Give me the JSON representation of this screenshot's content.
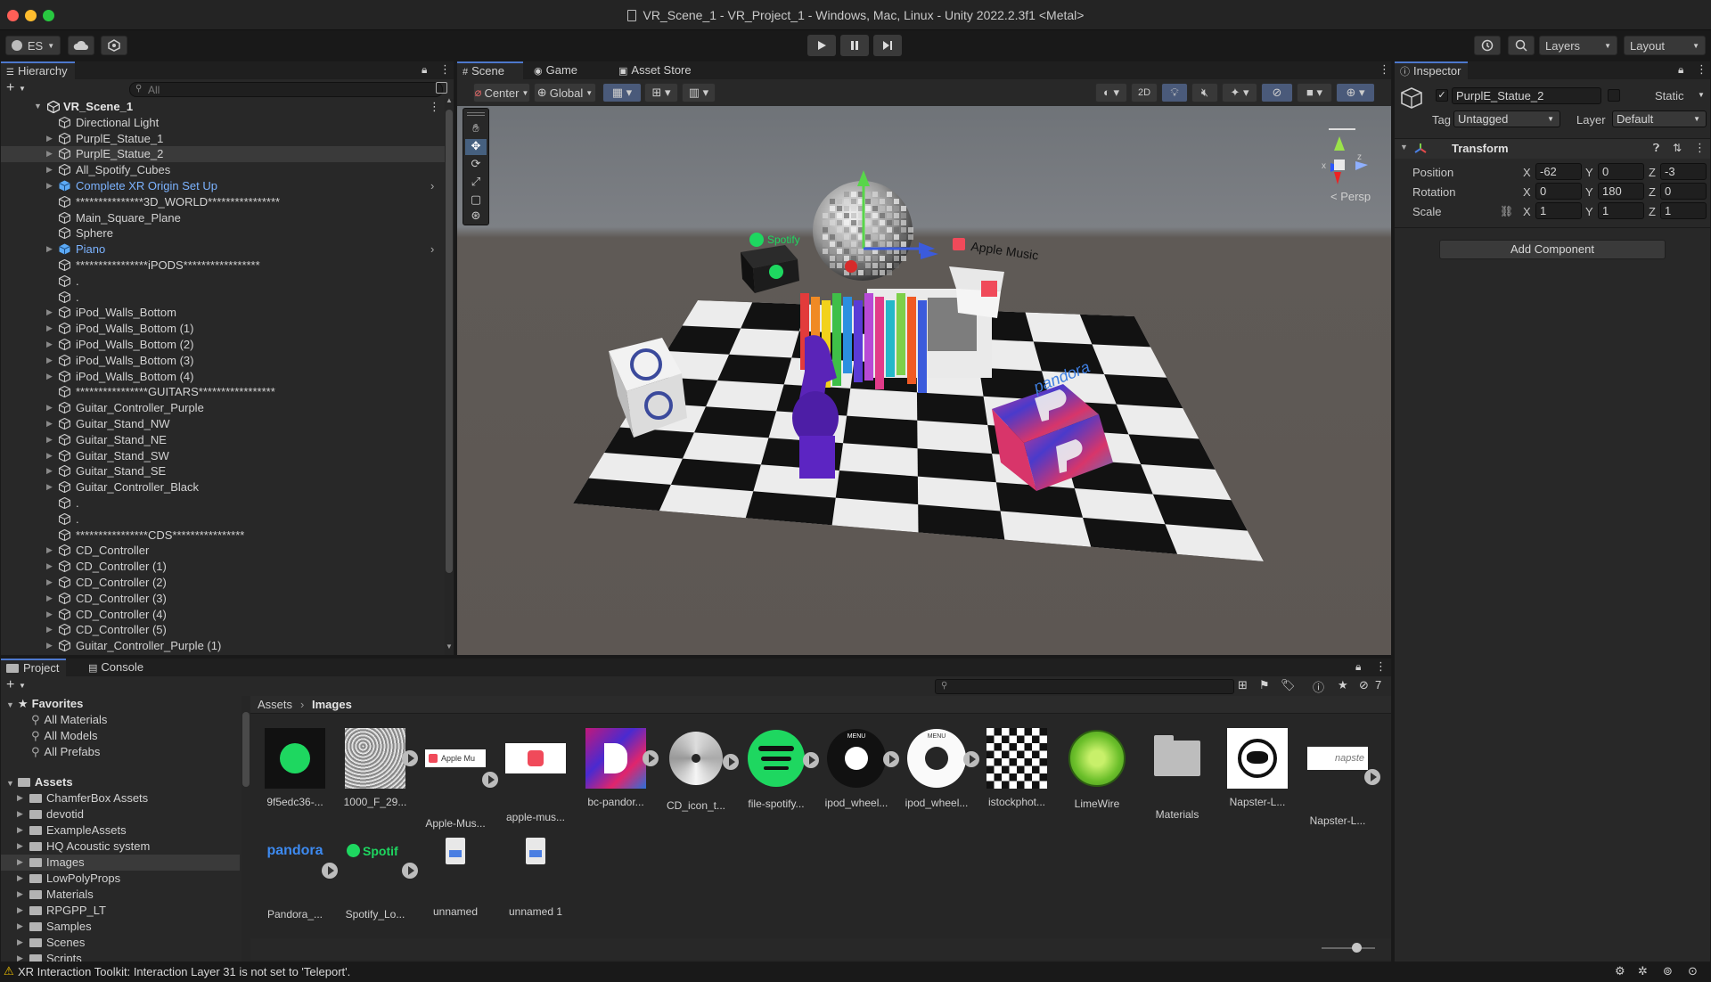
{
  "window": {
    "title": "VR_Scene_1 - VR_Project_1 - Windows, Mac, Linux - Unity 2022.2.3f1 <Metal>"
  },
  "toolbar": {
    "account": "ES",
    "layers": "Layers",
    "layout": "Layout"
  },
  "hierarchy": {
    "tab": "Hierarchy",
    "search_placeholder": "All",
    "scene_name": "VR_Scene_1",
    "items": [
      {
        "label": "Directional Light"
      },
      {
        "label": "PurplE_Statue_1"
      },
      {
        "label": "PurplE_Statue_2"
      },
      {
        "label": "All_Spotify_Cubes"
      },
      {
        "label": "Complete XR Origin Set Up"
      },
      {
        "label": "***************3D_WORLD****************"
      },
      {
        "label": "Main_Square_Plane"
      },
      {
        "label": "Sphere"
      },
      {
        "label": "Piano"
      },
      {
        "label": "****************iPODS*****************"
      },
      {
        "label": "."
      },
      {
        "label": "."
      },
      {
        "label": "iPod_Walls_Bottom"
      },
      {
        "label": "iPod_Walls_Bottom (1)"
      },
      {
        "label": "iPod_Walls_Bottom (2)"
      },
      {
        "label": "iPod_Walls_Bottom (3)"
      },
      {
        "label": "iPod_Walls_Bottom (4)"
      },
      {
        "label": "****************GUITARS*****************"
      },
      {
        "label": "Guitar_Controller_Purple"
      },
      {
        "label": "Guitar_Stand_NW"
      },
      {
        "label": "Guitar_Stand_NE"
      },
      {
        "label": "Guitar_Stand_SW"
      },
      {
        "label": "Guitar_Stand_SE"
      },
      {
        "label": "Guitar_Controller_Black"
      },
      {
        "label": "."
      },
      {
        "label": "."
      },
      {
        "label": "****************CDS****************"
      },
      {
        "label": "CD_Controller"
      },
      {
        "label": "CD_Controller (1)"
      },
      {
        "label": "CD_Controller (2)"
      },
      {
        "label": "CD_Controller (3)"
      },
      {
        "label": "CD_Controller (4)"
      },
      {
        "label": "CD_Controller (5)"
      },
      {
        "label": "Guitar_Controller_Purple (1)"
      }
    ]
  },
  "scene": {
    "tabs": [
      "Scene",
      "Game",
      "Asset Store"
    ],
    "pivot": "Center",
    "space": "Global",
    "mode_2d": "2D",
    "persp_label": "< Persp",
    "labels": {
      "spotify": "Spotify",
      "apple_music": "Apple Music",
      "pandora": "pandora"
    }
  },
  "inspector": {
    "tab": "Inspector",
    "object_name": "PurplE_Statue_2",
    "static_label": "Static",
    "tag_label": "Tag",
    "tag_value": "Untagged",
    "layer_label": "Layer",
    "layer_value": "Default",
    "component": "Transform",
    "position": {
      "label": "Position",
      "x": "-62",
      "y": "0",
      "z": "-3"
    },
    "rotation": {
      "label": "Rotation",
      "x": "0",
      "y": "180",
      "z": "0"
    },
    "scale": {
      "label": "Scale",
      "x": "1",
      "y": "1",
      "z": "1"
    },
    "add_component": "Add Component"
  },
  "project": {
    "tabs": [
      "Project",
      "Console"
    ],
    "favorites_label": "Favorites",
    "favorites": [
      "All Materials",
      "All Models",
      "All Prefabs"
    ],
    "assets_label": "Assets",
    "folders": [
      "ChamferBox Assets",
      "devotid",
      "ExampleAssets",
      "HQ Acoustic system",
      "Images",
      "LowPolyProps",
      "Materials",
      "RPGPP_LT",
      "Samples",
      "Scenes",
      "Scripts"
    ],
    "breadcrumb": [
      "Assets",
      "Images"
    ],
    "hidden_count": "7",
    "assets": [
      {
        "name": "9f5edc36-..."
      },
      {
        "name": "1000_F_29..."
      },
      {
        "name": "Apple-Mus..."
      },
      {
        "name": "apple-mus..."
      },
      {
        "name": "bc-pandor..."
      },
      {
        "name": "CD_icon_t..."
      },
      {
        "name": "file-spotify..."
      },
      {
        "name": "ipod_wheel..."
      },
      {
        "name": "ipod_wheel..."
      },
      {
        "name": "istockphot..."
      },
      {
        "name": "LimeWire"
      },
      {
        "name": "Materials"
      },
      {
        "name": "Napster-L..."
      },
      {
        "name": "Napster-L..."
      },
      {
        "name": "Pandora_..."
      },
      {
        "name": "Spotify_Lo..."
      },
      {
        "name": "unnamed"
      },
      {
        "name": "unnamed 1"
      }
    ],
    "thumb_text": {
      "apple_small": "Apple Mu",
      "pandora": "pandora",
      "spotify": "Spotif",
      "napster": "napste",
      "menu": "MENU"
    }
  },
  "status": {
    "message": "XR Interaction Toolkit: Interaction Layer 31 is not set to 'Teleport'."
  }
}
